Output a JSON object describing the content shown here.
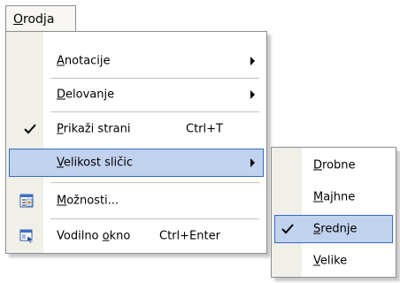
{
  "menubar": {
    "title": "Orodja",
    "title_rest": "rodja",
    "title_mnemonic": "O"
  },
  "menu": {
    "items": [
      {
        "mn": "A",
        "rest": "notacije"
      },
      {
        "mn": "D",
        "rest": "elovanje"
      },
      {
        "mn": "P",
        "rest": "rikaži strani",
        "shortcut": "Ctrl+T"
      },
      {
        "mn": "V",
        "rest": "elikost sličic"
      },
      {
        "mn": "M",
        "rest": "ožnosti..."
      },
      {
        "pre": "Vodilno ",
        "mn": "o",
        "rest": "kno",
        "shortcut": "Ctrl+Enter"
      }
    ]
  },
  "submenu": {
    "items": [
      {
        "mn": "D",
        "rest": "robne"
      },
      {
        "mn": "M",
        "rest": "ajhne"
      },
      {
        "mn": "S",
        "rest": "rednje"
      },
      {
        "mn": "V",
        "rest": "elike"
      }
    ]
  },
  "icons": {
    "check": "check-icon",
    "options": "options-icon",
    "guide_pane": "guide-pane-icon",
    "submenu_arrow": "submenu-arrow-icon"
  },
  "colors": {
    "highlight_fill": "#c1d2ee",
    "highlight_border": "#316ac5",
    "gutter": "#f0efe8",
    "menu_border": "#8c8c8c"
  }
}
